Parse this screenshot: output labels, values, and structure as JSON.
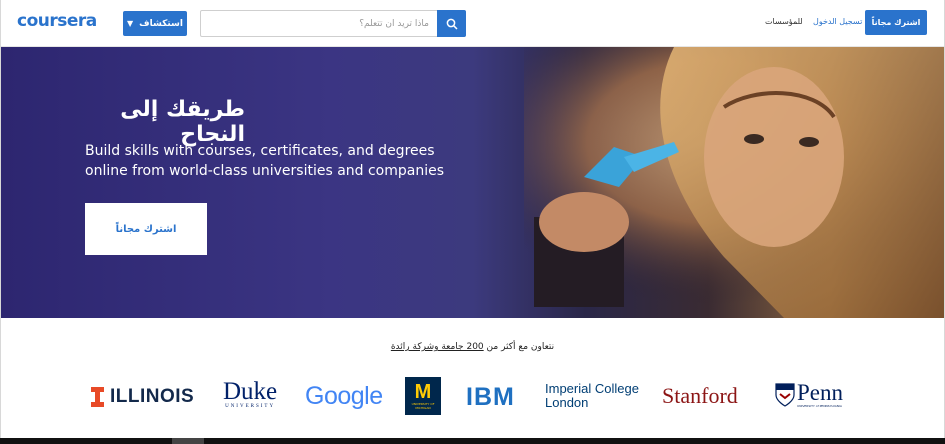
{
  "header": {
    "logo": "coursera",
    "explore_label": "استكشاف",
    "search_placeholder": "ماذا تريد أن تتعلم؟",
    "nav_institutions": "للمؤسسات",
    "nav_login": "تسجيل الدخول",
    "join_label": "اشترك مجاناً"
  },
  "hero": {
    "title": "طريقك إلى النجاح",
    "subtitle": "Build skills with courses, certificates, and degrees online from world-class universities and companies",
    "cta_label": "اشترك مجاناً"
  },
  "partners": {
    "heading_prefix": "نتعاون مع أكثر من",
    "heading_link": "200 جامعة وشركة رائدة",
    "logos": [
      {
        "name": "ILLINOIS"
      },
      {
        "name": "Duke",
        "sub": "UNIVERSITY"
      },
      {
        "name": "Google"
      },
      {
        "name": "M",
        "sub": "UNIVERSITY OF MICHIGAN"
      },
      {
        "name": "IBM"
      },
      {
        "name": "Imperial College",
        "line2": "London"
      },
      {
        "name": "Stanford"
      },
      {
        "name": "Penn",
        "sub": "UNIVERSITY of PENNSYLVANIA"
      }
    ]
  },
  "colors": {
    "brand": "#2a73cc",
    "illinois": "#e84a27",
    "duke": "#012169",
    "michigan": "#00274c",
    "michigan_maize": "#ffcb05",
    "ibm": "#1f70c1",
    "imperial": "#003e74",
    "stanford": "#8c1515",
    "penn": "#011f5b"
  }
}
